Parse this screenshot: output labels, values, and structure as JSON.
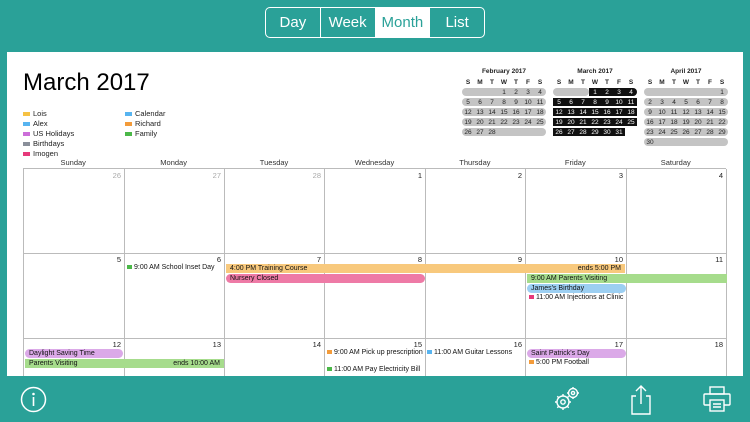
{
  "tabs": [
    {
      "label": "Day",
      "active": false
    },
    {
      "label": "Week",
      "active": false
    },
    {
      "label": "Month",
      "active": true
    },
    {
      "label": "List",
      "active": false
    }
  ],
  "title": "March 2017",
  "legend": [
    {
      "label": "Lois",
      "color": "#f6c244"
    },
    {
      "label": "Alex",
      "color": "#57b4f0"
    },
    {
      "label": "US Holidays",
      "color": "#cc6ed9"
    },
    {
      "label": "Birthdays",
      "color": "#8a8f9a"
    },
    {
      "label": "Imogen",
      "color": "#e6397a"
    },
    {
      "label": "Calendar",
      "color": "#57b4f0"
    },
    {
      "label": "Richard",
      "color": "#f39b3a"
    },
    {
      "label": "Family",
      "color": "#4bb848"
    }
  ],
  "mini_calendars": [
    {
      "title": "February 2017",
      "dows": [
        "S",
        "M",
        "T",
        "W",
        "T",
        "F",
        "S"
      ],
      "rows": [
        [
          "",
          "",
          "",
          "1",
          "2",
          "3",
          "4"
        ],
        [
          "5",
          "6",
          "7",
          "8",
          "9",
          "10",
          "11"
        ],
        [
          "12",
          "13",
          "14",
          "15",
          "16",
          "17",
          "18"
        ],
        [
          "19",
          "20",
          "21",
          "22",
          "23",
          "24",
          "25"
        ],
        [
          "26",
          "27",
          "28",
          "",
          "",
          "",
          ""
        ]
      ]
    },
    {
      "title": "March 2017",
      "dows": [
        "S",
        "M",
        "T",
        "W",
        "T",
        "F",
        "S"
      ],
      "rows": [
        [
          "",
          "",
          "",
          "1",
          "2",
          "3",
          "4"
        ],
        [
          "5",
          "6",
          "7",
          "8",
          "9",
          "10",
          "11"
        ],
        [
          "12",
          "13",
          "14",
          "15",
          "16",
          "17",
          "18"
        ],
        [
          "19",
          "20",
          "21",
          "22",
          "23",
          "24",
          "25"
        ],
        [
          "26",
          "27",
          "28",
          "29",
          "30",
          "31",
          ""
        ]
      ]
    },
    {
      "title": "April 2017",
      "dows": [
        "S",
        "M",
        "T",
        "W",
        "T",
        "F",
        "S"
      ],
      "rows": [
        [
          "",
          "",
          "",
          "",
          "",
          "",
          "1"
        ],
        [
          "2",
          "3",
          "4",
          "5",
          "6",
          "7",
          "8"
        ],
        [
          "9",
          "10",
          "11",
          "12",
          "13",
          "14",
          "15"
        ],
        [
          "16",
          "17",
          "18",
          "19",
          "20",
          "21",
          "22"
        ],
        [
          "23",
          "24",
          "25",
          "26",
          "27",
          "28",
          "29"
        ],
        [
          "30",
          "",
          "",
          "",
          "",
          "",
          ""
        ]
      ]
    }
  ],
  "weekdays": [
    "Sunday",
    "Monday",
    "Tuesday",
    "Wednesday",
    "Thursday",
    "Friday",
    "Saturday"
  ],
  "weeks": [
    [
      {
        "d": "26",
        "dim": true
      },
      {
        "d": "27",
        "dim": true
      },
      {
        "d": "28",
        "dim": true
      },
      {
        "d": "1"
      },
      {
        "d": "2"
      },
      {
        "d": "3"
      },
      {
        "d": "4"
      }
    ],
    [
      {
        "d": "5"
      },
      {
        "d": "6"
      },
      {
        "d": "7"
      },
      {
        "d": "8"
      },
      {
        "d": "9"
      },
      {
        "d": "10"
      },
      {
        "d": "11"
      }
    ],
    [
      {
        "d": "12"
      },
      {
        "d": "13"
      },
      {
        "d": "14"
      },
      {
        "d": "15"
      },
      {
        "d": "16"
      },
      {
        "d": "17"
      },
      {
        "d": "18"
      }
    ]
  ],
  "events": {
    "school_inset": "9:00 AM School Inset Day",
    "training": "4:00 PM Training Course",
    "training_end": "ends 5:00 PM",
    "nursery": "Nursery Closed",
    "parents_visiting_1": "9:00 AM Parents Visiting",
    "james_birthday": "James's Birthday",
    "injections": "11:00 AM Injections at Clinic",
    "daylight": "Daylight Saving Time",
    "parents_visiting_2": "Parents Visiting",
    "parents_end": "ends 10:00 AM",
    "pickup": "9:00 AM Pick up prescription",
    "electricity": "11:00 AM Pay Electricity Bill",
    "guitar": "11:00 AM Guitar Lessons",
    "patrick": "Saint Patrick's Day",
    "football": "5:00 PM Football"
  },
  "colors": {
    "teal": "#2aa198",
    "training": "#f8c97d",
    "nursery": "#ee7aa6",
    "family_green": "#a6dc8c",
    "birthday_blue": "#9ccff2",
    "holiday_purple": "#dba9e8"
  },
  "bottom_icons": [
    "info-icon",
    "settings-gears-icon",
    "share-icon",
    "print-icon"
  ]
}
